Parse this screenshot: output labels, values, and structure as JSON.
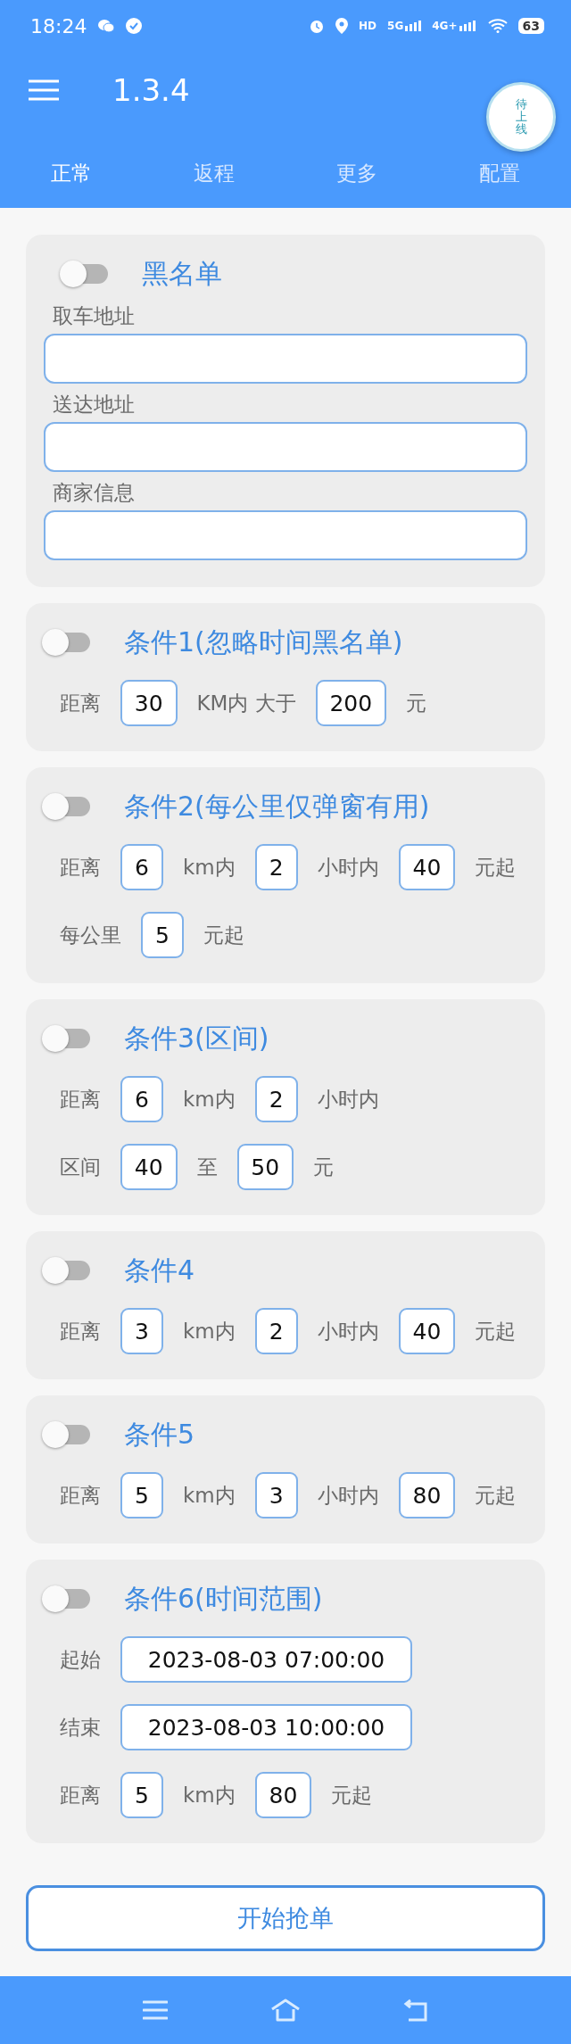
{
  "status_bar": {
    "time": "18:24",
    "hd": "HD",
    "networks": [
      "5G",
      "4G+"
    ],
    "battery": "63"
  },
  "toolbar": {
    "title": "1.3.4"
  },
  "tabs": [
    {
      "label": "正常",
      "selected": true
    },
    {
      "label": "返程",
      "selected": false
    },
    {
      "label": "更多",
      "selected": false
    },
    {
      "label": "配置",
      "selected": false
    }
  ],
  "floating_button": {
    "label": "待上线"
  },
  "blacklist": {
    "title": "黑名单",
    "on": false,
    "fields": [
      {
        "label": "取车地址"
      },
      {
        "label": "送达地址"
      },
      {
        "label": "商家信息"
      }
    ]
  },
  "conditions": [
    {
      "title": "条件1(忽略时间黑名单)",
      "on": false,
      "rows": [
        [
          {
            "kind": "text",
            "text": "距离"
          },
          {
            "kind": "input",
            "value": "30"
          },
          {
            "kind": "text",
            "text": "KM内 大于"
          },
          {
            "kind": "input",
            "value": "200"
          },
          {
            "kind": "text",
            "text": "元"
          }
        ]
      ]
    },
    {
      "title": "条件2(每公里仅弹窗有用)",
      "on": false,
      "rows": [
        [
          {
            "kind": "text",
            "text": "距离"
          },
          {
            "kind": "input",
            "value": "6"
          },
          {
            "kind": "text",
            "text": "km内"
          },
          {
            "kind": "input",
            "value": "2"
          },
          {
            "kind": "text",
            "text": "小时内"
          },
          {
            "kind": "input",
            "value": "40"
          },
          {
            "kind": "text",
            "text": "元起"
          }
        ],
        [
          {
            "kind": "text",
            "text": "每公里"
          },
          {
            "kind": "input",
            "value": "5"
          },
          {
            "kind": "text",
            "text": "元起"
          }
        ]
      ]
    },
    {
      "title": "条件3(区间)",
      "on": false,
      "rows": [
        [
          {
            "kind": "text",
            "text": "距离"
          },
          {
            "kind": "input",
            "value": "6"
          },
          {
            "kind": "text",
            "text": "km内"
          },
          {
            "kind": "input",
            "value": "2"
          },
          {
            "kind": "text",
            "text": "小时内"
          }
        ],
        [
          {
            "kind": "text",
            "text": "区间"
          },
          {
            "kind": "input",
            "value": "40"
          },
          {
            "kind": "text",
            "text": "至"
          },
          {
            "kind": "input",
            "value": "50"
          },
          {
            "kind": "text",
            "text": "元"
          }
        ]
      ]
    },
    {
      "title": "条件4",
      "on": false,
      "rows": [
        [
          {
            "kind": "text",
            "text": "距离"
          },
          {
            "kind": "input",
            "value": "3"
          },
          {
            "kind": "text",
            "text": "km内"
          },
          {
            "kind": "input",
            "value": "2"
          },
          {
            "kind": "text",
            "text": "小时内"
          },
          {
            "kind": "input",
            "value": "40"
          },
          {
            "kind": "text",
            "text": "元起"
          }
        ]
      ]
    },
    {
      "title": "条件5",
      "on": false,
      "rows": [
        [
          {
            "kind": "text",
            "text": "距离"
          },
          {
            "kind": "input",
            "value": "5"
          },
          {
            "kind": "text",
            "text": "km内"
          },
          {
            "kind": "input",
            "value": "3"
          },
          {
            "kind": "text",
            "text": "小时内"
          },
          {
            "kind": "input",
            "value": "80"
          },
          {
            "kind": "text",
            "text": "元起"
          }
        ]
      ]
    },
    {
      "title": "条件6(时间范围)",
      "on": false,
      "rows": [
        [
          {
            "kind": "text",
            "text": "起始"
          },
          {
            "kind": "input",
            "value": "2023-08-03 07:00:00"
          }
        ],
        [
          {
            "kind": "text",
            "text": "结束"
          },
          {
            "kind": "input",
            "value": "2023-08-03 10:00:00"
          }
        ],
        [
          {
            "kind": "text",
            "text": "距离"
          },
          {
            "kind": "input",
            "value": "5"
          },
          {
            "kind": "text",
            "text": "km内"
          },
          {
            "kind": "input",
            "value": "80"
          },
          {
            "kind": "text",
            "text": "元起"
          }
        ]
      ]
    }
  ],
  "start_button": {
    "label": "开始抢单"
  }
}
